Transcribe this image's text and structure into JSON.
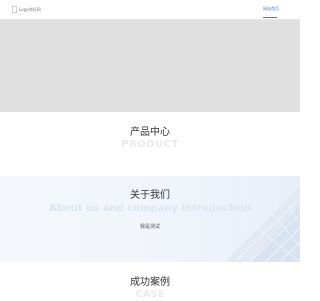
{
  "header": {
    "logo_text": "Logo你好网",
    "nav": [
      {
        "label": "网站首页",
        "active": true
      }
    ]
  },
  "products": {
    "title": "产品中心",
    "subtitle_en": "PRODUCT"
  },
  "about": {
    "title": "关于我们",
    "subtitle_en": "About us and company introduction",
    "subtext": "我是测试"
  },
  "cases": {
    "title": "成功案例",
    "subtitle_en": "CASE"
  },
  "colors": {
    "accent": "#3b7bd4",
    "banner": "#e0e0e0",
    "text": "#333333",
    "ghost_text": "#ebebeb"
  }
}
